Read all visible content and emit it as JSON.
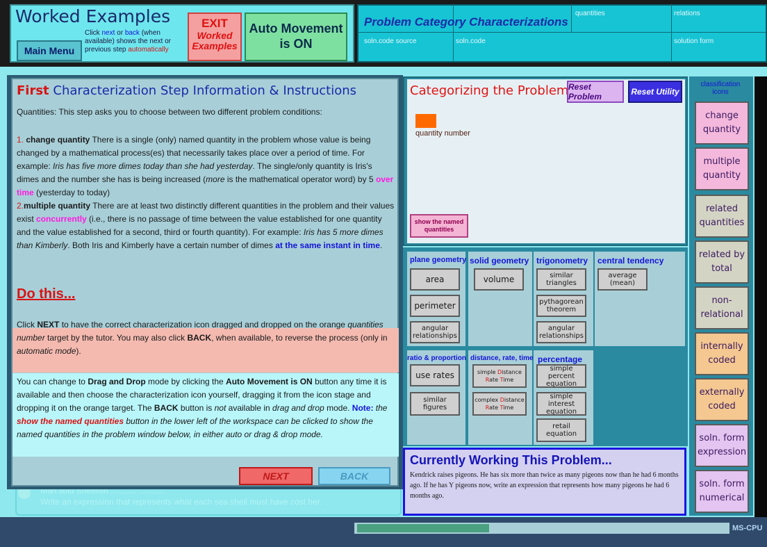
{
  "header": {
    "title": "Worked Examples",
    "main_menu": "Main Menu",
    "help": {
      "p1": "Click ",
      "next": "next",
      "p2": " or ",
      "back": "back",
      "p3": " (when available) shows the next or previous step ",
      "auto": "automatically"
    },
    "exit": {
      "l1": "EXIT",
      "l2": "Worked",
      "l3": "Examples"
    },
    "auto_movement": {
      "l1": "Auto Movement",
      "l2": "is ON"
    }
  },
  "pcc": {
    "title": "Problem Category Characterizations",
    "quantities": "quantities",
    "relations": "relations",
    "soln_code_source": "soln.code source",
    "soln_code": "soln.code",
    "solution_form": "solution form"
  },
  "instructions": {
    "title_first": "First",
    "title_rest": " Characterization Step Information & Instructions",
    "intro": "Quantities: This step asks you to choose between two different problem conditions:",
    "item1_num": "1.",
    "item1_bold": " change quantity",
    "item1_a": " There is a single (only) named quantity in the problem whose value is being changed by a mathematical process(es) that necessarily takes place over a period of time. For example: ",
    "item1_ex": "Iris has five more dimes today than she had yesterday",
    "item1_b": ". The single/only quantity is Iris's dimes and the number she has is being increased (",
    "item1_more": "more",
    "item1_c": " is the mathematical operator word) by 5 ",
    "item1_overtime": "over time",
    "item1_d": " (yesterday to today)",
    "item2_num": "2.",
    "item2_bold": "multiple quantity",
    "item2_a": " There are at least two distinctly different quantities in the problem and their values exist ",
    "item2_conc": "concurrently",
    "item2_b": " (i.e., there is no passage of time between the value established for one quantity and the value established for a second, third or fourth quantity). For example: ",
    "item2_ex": "Iris has 5 more dimes than Kimberly",
    "item2_c": ". Both Iris and Kimberly have a certain number of dimes ",
    "item2_same": "at the same instant in time",
    "item2_d": ".",
    "do_this": "Do this...",
    "click_a": " Click ",
    "click_next": "NEXT",
    "click_b": " to have the correct characterization icon dragged and dropped on the orange ",
    "click_qn": "quantities number",
    "click_c": " target by the tutor. You may also click ",
    "click_back": "BACK",
    "click_d": ", when available, to reverse the process (only in ",
    "click_auto": "automatic mode",
    "click_e": ").",
    "dd_a": "You can change to ",
    "dd_bold": "Drag and Drop",
    "dd_b": " mode by clicking the ",
    "dd_auto": "Auto Movement is ON",
    "dd_c": " button any time it is available and then choose the characterization icon yourself, dragging it from the icon stage and dropping it on the orange target. The ",
    "dd_back": "BACK",
    "dd_d": " button is ",
    "dd_not": "not",
    "dd_e": " available in ",
    "dd_ddm": "drag and drop",
    "dd_f": " mode. ",
    "dd_note": "Note:",
    "dd_g": " the ",
    "dd_show": "show the named quantities",
    "dd_h": " button in the lower left of the workspace can be clicked to show the named quantities in the problem window below, in either auto or drag & drop mode.",
    "next": "NEXT",
    "back": "BACK",
    "ghost_line1": "Mah sold Shellfish   ...........   ............",
    "ghost_line2": "Write an expression that represents what each sea shell must have cost her."
  },
  "categorizing": {
    "title": "Categorizing the Problem",
    "reset_problem": "Reset Problem",
    "reset_utility": "Reset Utility",
    "target_label": "quantity number",
    "show_named": "show the named quantities"
  },
  "icons": {
    "plane_geometry": "plane geometry",
    "solid_geometry": "solid geometry",
    "trigonometry": "trigonometry",
    "central_tendency": "central tendency",
    "area": "area",
    "volume": "volume",
    "similar_triangles": "similar triangles",
    "average": "average (mean)",
    "perimeter": "perimeter",
    "pythagorean": "pythagorean theorem",
    "angular1": "angular relationships",
    "angular2": "angular relationships",
    "ratio": "ratio & proportion",
    "drt": "distance, rate, time",
    "percentage": "percentage",
    "use_rates": "use rates",
    "simple_drt_a": "simple ",
    "simple_drt_d": "D",
    "simple_drt_b": "istance",
    "simple_drt_r": "R",
    "simple_drt_c": "ate ",
    "simple_drt_t": "T",
    "simple_drt_e": "ime",
    "complex_drt_a": "complex ",
    "complex_drt_b": "istance",
    "complex_drt_c": "ate ",
    "complex_drt_e": "ime",
    "simple_percent": "simple percent equation",
    "similar_figures": "similar figures",
    "simple_interest": "simple interest equation",
    "retail": "retail equation"
  },
  "current_problem": {
    "title": "Currently Working This Problem...",
    "text": "Kendrick raises pigeons. He has six more than twice as many pigeons now than he had 6 months ago. If he has  Y pigeons now, write an expression that represents how many pigeons he had 6 months ago."
  },
  "classification": {
    "label": "classification icons",
    "items": [
      {
        "label": "change quantity",
        "color": "#f4b8dc"
      },
      {
        "label": "multiple quantity",
        "color": "#f4b8dc"
      },
      {
        "label": "related quantities",
        "color": "#d4d4c4"
      },
      {
        "label": "related by total",
        "color": "#d4d4c4"
      },
      {
        "label": "non-relational",
        "color": "#d4d4c4"
      },
      {
        "label": "internally coded",
        "color": "#f4c890"
      },
      {
        "label": "externally coded",
        "color": "#f4c890"
      },
      {
        "label": "soln. form expression",
        "color": "#e4c4f0"
      },
      {
        "label": "soln. form numerical",
        "color": "#e4c4f0"
      }
    ]
  },
  "status": {
    "cpu": "MS-CPU"
  }
}
